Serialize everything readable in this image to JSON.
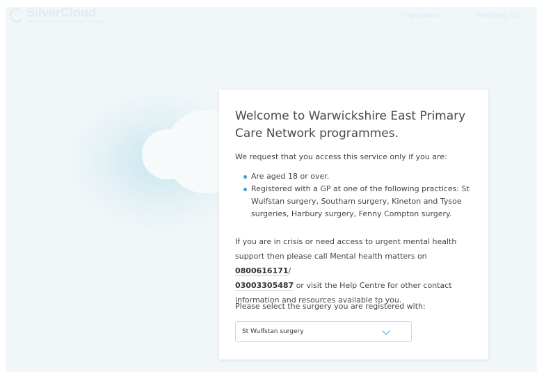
{
  "header": {
    "logo_name": "SilverCloud",
    "logo_tagline": "people. care. outcomes. online",
    "nav": [
      {
        "label": "Programmes"
      },
      {
        "label": "Wellbeing Tips"
      }
    ]
  },
  "card": {
    "title": "Welcome to Warwickshire East Primary Care Network programmes.",
    "intro": "We request that you access this service only if you are:",
    "criteria": [
      "Are aged 18 or over.",
      "Registered with a GP at one of the following practices: St Wulfstan surgery, Southam surgery, Kineton and Tysoe surgeries, Harbury surgery, Fenny Compton surgery."
    ],
    "crisis": {
      "text_before": "If you are in crisis or need access to urgent mental health support then please call Mental health matters on ",
      "phone_1": "0800616171",
      "separator": "/",
      "phone_2": "03003305487",
      "text_after": " or visit the Help Centre for other contact information and resources available to you."
    },
    "select_label": "Please select the surgery you are registered with:",
    "select": {
      "selected": "St Wulfstan surgery"
    }
  },
  "colors": {
    "accent": "#27a7d6",
    "background": "#f1f6f8",
    "card": "#ffffff",
    "text": "#444444"
  },
  "icons": {
    "dropdown": "chevron-down-icon",
    "bullet": "bullet-icon"
  }
}
